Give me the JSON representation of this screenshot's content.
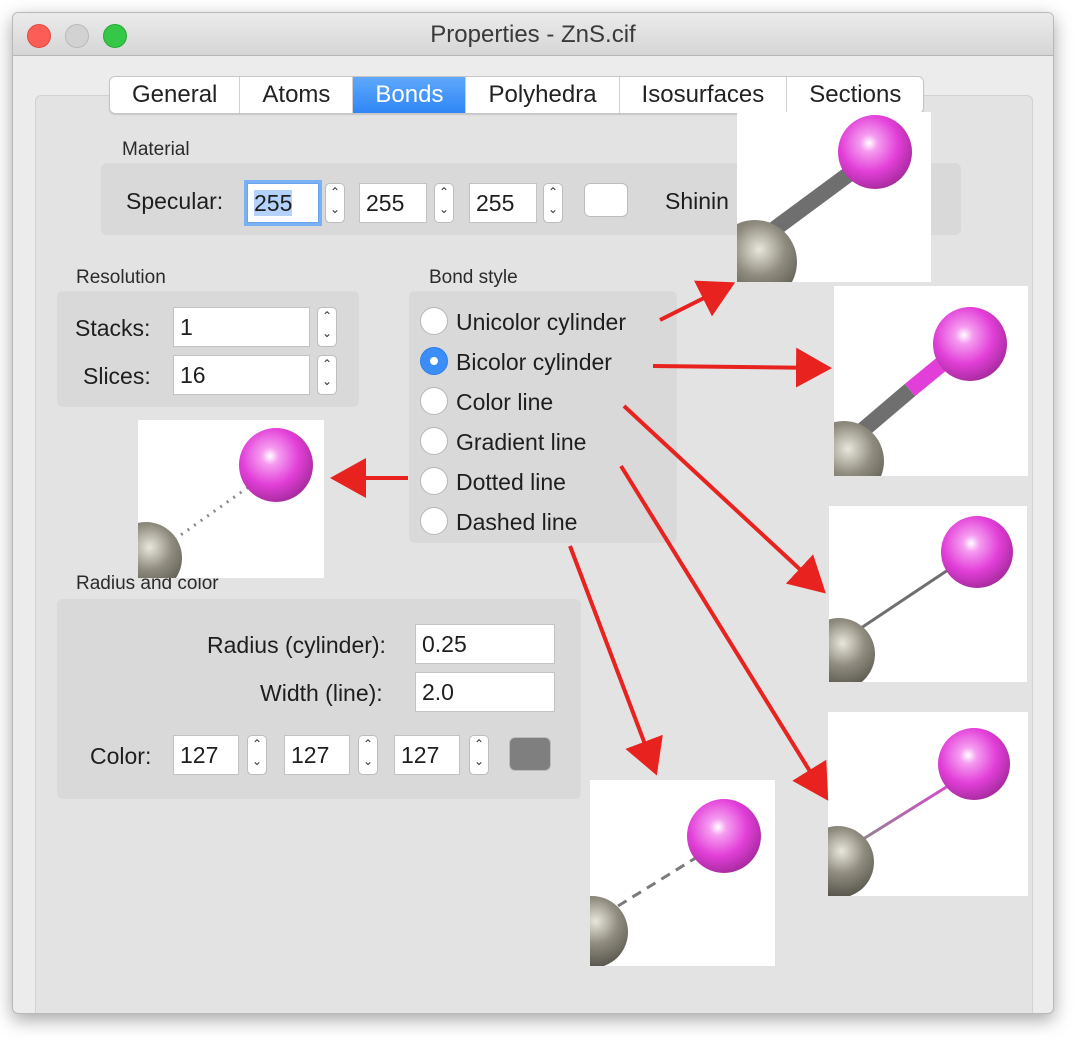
{
  "window": {
    "title": "Properties - ZnS.cif"
  },
  "tabs": [
    {
      "label": "General",
      "active": false
    },
    {
      "label": "Atoms",
      "active": false
    },
    {
      "label": "Bonds",
      "active": true
    },
    {
      "label": "Polyhedra",
      "active": false
    },
    {
      "label": "Isosurfaces",
      "active": false
    },
    {
      "label": "Sections",
      "active": false
    }
  ],
  "material": {
    "group_label": "Material",
    "specular_label": "Specular:",
    "specular_values": [
      "255",
      "255",
      "255"
    ],
    "shininess_label": "Shinin",
    "specular_swatch_color": "#ffffff"
  },
  "resolution": {
    "group_label": "Resolution",
    "stacks_label": "Stacks:",
    "stacks_value": "1",
    "slices_label": "Slices:",
    "slices_value": "16"
  },
  "bond_style": {
    "group_label": "Bond style",
    "options": [
      {
        "label": "Unicolor cylinder",
        "selected": false
      },
      {
        "label": "Bicolor cylinder",
        "selected": true
      },
      {
        "label": "Color line",
        "selected": false
      },
      {
        "label": "Gradient line",
        "selected": false
      },
      {
        "label": "Dotted line",
        "selected": false
      },
      {
        "label": "Dashed line",
        "selected": false
      }
    ]
  },
  "radius_color": {
    "group_label": "Radius and color",
    "radius_label": "Radius (cylinder):",
    "radius_value": "0.25",
    "width_label": "Width (line):",
    "width_value": "2.0",
    "color_label": "Color:",
    "color_values": [
      "127",
      "127",
      "127"
    ],
    "color_swatch": "#7f7f7f"
  },
  "colors": {
    "accent": "#2f86f6",
    "arrow": "#e8231f",
    "atom_pink": "#e23fd8",
    "atom_gray": "#7d7b6e",
    "bond_gray": "#6f6f6f"
  }
}
